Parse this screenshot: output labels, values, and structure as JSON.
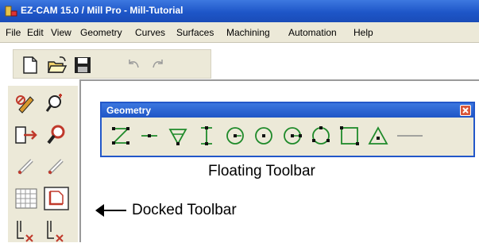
{
  "window": {
    "title": "EZ-CAM 15.0 / Mill Pro  - Mill-Tutorial"
  },
  "menu": {
    "items": [
      "File",
      "Edit",
      "View",
      "Geometry",
      "Curves",
      "Surfaces",
      "Machining",
      "Automation",
      "Help"
    ]
  },
  "standard_toolbar": {
    "icons": [
      "new-file-icon",
      "open-folder-icon",
      "save-disk-icon",
      "undo-icon",
      "redo-icon"
    ]
  },
  "docked_toolbar": {
    "icons": [
      "pencil-icon",
      "zoom-window-icon",
      "arrow-extend-icon",
      "magnifier-icon",
      "chain-link-icon",
      "chain-link-alt-icon",
      "grid-icon",
      "rectangle-corner-icon",
      "tool-path-icon",
      "tool-path-alt-icon"
    ]
  },
  "floating_toolbar": {
    "title": "Geometry",
    "icons": [
      "zigzag-line-icon",
      "horizontal-line-icon",
      "triangle-cut-icon",
      "i-beam-line-icon",
      "circle-arrow-icon",
      "circle-point-icon",
      "circle-dot-arrow-icon",
      "circle-three-point-icon",
      "rectangle-icon",
      "triangle-icon",
      "long-line-icon"
    ]
  },
  "annotations": {
    "floating_label": "Floating Toolbar",
    "docked_label": "Docked Toolbar"
  },
  "colors": {
    "titlebar": "#1e56c8",
    "toolbar_bg": "#ece9d8",
    "geometry_icon": "#1f8a2a",
    "point_color": "#111111"
  }
}
